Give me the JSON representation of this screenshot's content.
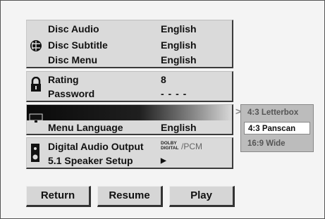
{
  "menu": {
    "language": {
      "disc_audio": {
        "label": "Disc Audio",
        "value": "English"
      },
      "disc_subtitle": {
        "label": "Disc Subtitle",
        "value": "English"
      },
      "disc_menu": {
        "label": "Disc Menu",
        "value": "English"
      }
    },
    "lock": {
      "rating": {
        "label": "Rating",
        "value": "8"
      },
      "password": {
        "label": "Password",
        "value": "- - - -"
      }
    },
    "display": {
      "menu_language": {
        "label": "Menu Language",
        "value": "English"
      }
    },
    "audio": {
      "digital_audio_output": {
        "label": "Digital Audio Output",
        "dolby_top": "DOLBY",
        "dolby_bottom": "DIGITAL",
        "pcm": "/PCM"
      },
      "speaker_setup": {
        "label": "5.1 Speaker Setup",
        "arrow": "▶"
      }
    }
  },
  "submenu": {
    "arrow": ">",
    "options": [
      "4:3 Letterbox",
      "4:3 Panscan",
      "16:9 Wide"
    ],
    "selected": "4:3 Panscan"
  },
  "buttons": {
    "return": "Return",
    "resume": "Resume",
    "play": "Play"
  },
  "colors": {
    "panel": "#dadada",
    "selected_bar": "#0a0a0a",
    "submenu": "#bcbcbc"
  }
}
